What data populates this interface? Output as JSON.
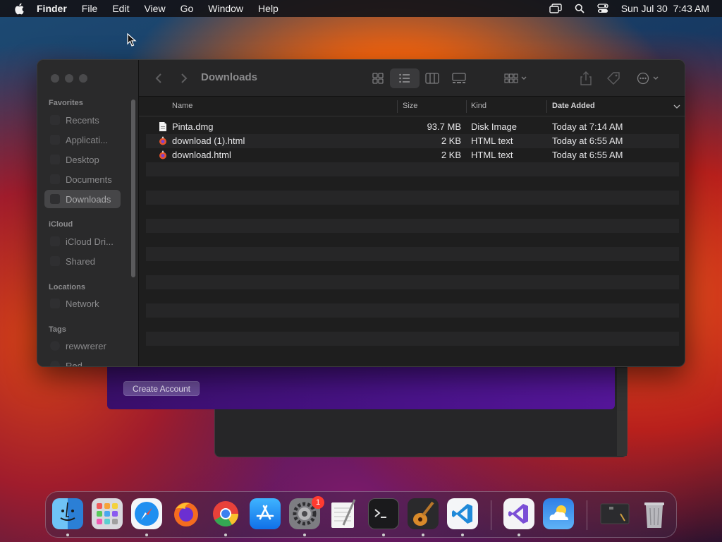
{
  "menubar": {
    "app_name": "Finder",
    "items": [
      "File",
      "Edit",
      "View",
      "Go",
      "Window",
      "Help"
    ],
    "datetime": "Sun Jul 30  7:43 AM"
  },
  "finder": {
    "title": "Downloads",
    "sidebar": {
      "favorites_label": "Favorites",
      "favorites": [
        "Recents",
        "Applicati...",
        "Desktop",
        "Documents",
        "Downloads"
      ],
      "icloud_label": "iCloud",
      "icloud": [
        "iCloud Dri...",
        "Shared"
      ],
      "locations_label": "Locations",
      "locations": [
        "Network"
      ],
      "tags_label": "Tags",
      "tags": [
        "rewwrerer",
        "Red"
      ],
      "selected": "Downloads"
    },
    "columns": {
      "name": "Name",
      "size": "Size",
      "kind": "Kind",
      "date": "Date Added"
    },
    "files": [
      {
        "name": "Pinta.dmg",
        "size": "93.7 MB",
        "kind": "Disk Image",
        "date": "Today at 7:14 AM",
        "icon": "disk-image-icon"
      },
      {
        "name": "download (1).html",
        "size": "2 KB",
        "kind": "HTML text",
        "date": "Today at 6:55 AM",
        "icon": "html-file-icon"
      },
      {
        "name": "download.html",
        "size": "2 KB",
        "kind": "HTML text",
        "date": "Today at 6:55 AM",
        "icon": "html-file-icon"
      }
    ]
  },
  "background_window": {
    "button_label": "Create Account"
  },
  "dock": {
    "apps": [
      "Finder",
      "Launchpad",
      "Safari",
      "Firefox",
      "Chrome",
      "App Store",
      "System Settings",
      "TextEdit",
      "Terminal",
      "GarageBand",
      "Visual Studio Code",
      "Visual Studio",
      "Weather",
      "Preview",
      "Trash"
    ],
    "settings_badge": "1"
  },
  "colors": {
    "finder_bg": "#1e1e1e",
    "sidebar_bg": "#2a2a2b",
    "purple_window": "#4a138a",
    "badge": "#ff3b30"
  }
}
